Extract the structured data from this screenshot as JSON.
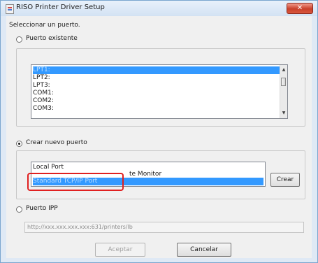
{
  "window": {
    "title": "RISO Printer Driver Setup",
    "close_label": "✕"
  },
  "dialog": {
    "prompt": "Seleccionar un puerto."
  },
  "existing_port": {
    "label": "Puerto existente",
    "selected": false,
    "items": [
      "LPT1:",
      "LPT2:",
      "LPT3:",
      "COM1:",
      "COM2:",
      "COM3:"
    ],
    "selected_item": "LPT1:"
  },
  "new_port": {
    "label": "Crear nuevo puerto",
    "selected": true,
    "items": [
      "Local Port",
      "te Monitor",
      "Standard TCP/IP Port"
    ],
    "selected_item": "Standard TCP/IP Port",
    "create_label": "Crear"
  },
  "ipp_port": {
    "label": "Puerto IPP",
    "selected": false,
    "url_placeholder": "http://xxx.xxx.xxx.xxx:631/printers/lb"
  },
  "buttons": {
    "accept_label": "Aceptar",
    "cancel_label": "Cancelar"
  },
  "colors": {
    "selection": "#3399ff",
    "highlight_box": "#e02020",
    "close_button": "#c9402b"
  }
}
